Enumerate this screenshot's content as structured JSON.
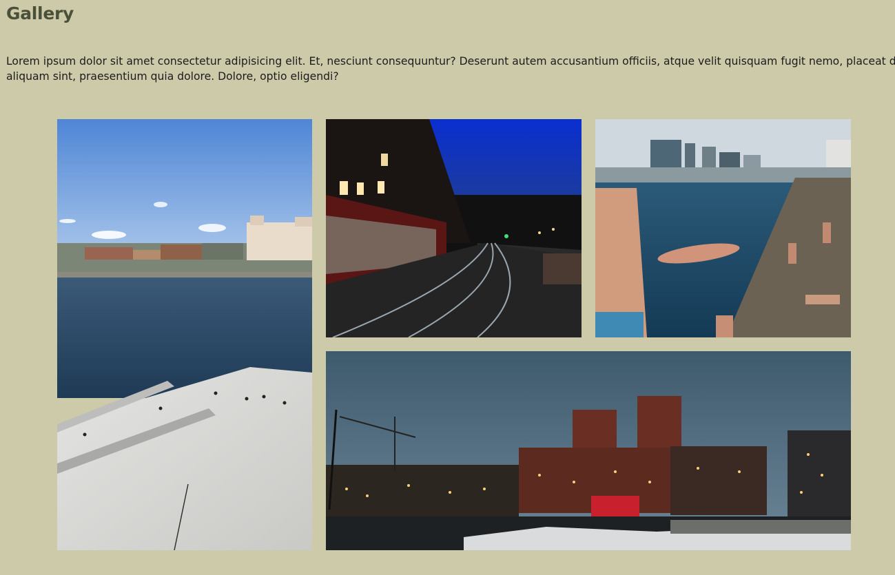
{
  "header": {
    "title": "Gallery"
  },
  "intro": {
    "text": "Lorem ipsum dolor sit amet consectetur adipisicing elit. Et, nesciunt consequuntur? Deserunt autem accusantium officiis, atque velit quisquam fugit nemo, placeat delectus aliquam sint, praesentium quia dolore. Dolore, optio eligendi?"
  },
  "gallery": {
    "images": [
      {
        "subject": "harbor view from opera house roof"
      },
      {
        "subject": "tram street at night"
      },
      {
        "subject": "harbor swimming pier"
      },
      {
        "subject": "city hall at dusk"
      }
    ]
  },
  "colors": {
    "background": "#cdcaa9",
    "title": "#4b5139",
    "text": "#1c1c1c"
  }
}
